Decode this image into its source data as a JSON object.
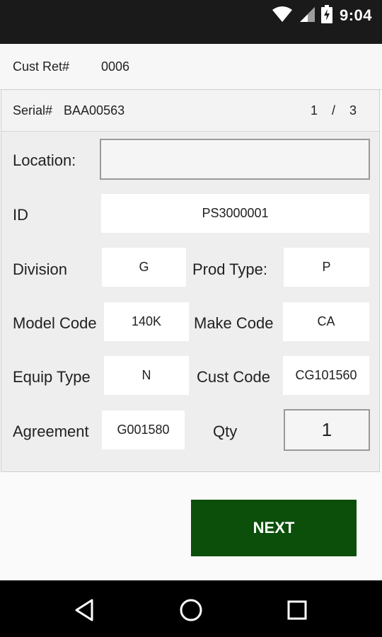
{
  "status_bar": {
    "time": "9:04",
    "icons": [
      "wifi-icon",
      "cell-signal-icon",
      "battery-icon"
    ]
  },
  "header": {
    "cust_ret_label": "Cust Ret#",
    "cust_ret_value": "0006"
  },
  "record": {
    "serial_label": "Serial#",
    "serial_value": "BAA00563",
    "page_current": "1",
    "page_separator": "/",
    "page_total": "3"
  },
  "form": {
    "location_label": "Location:",
    "location_value": "",
    "id_label": "ID",
    "id_value": "PS3000001",
    "division_label": "Division",
    "division_value": "G",
    "prod_type_label": "Prod Type:",
    "prod_type_value": "P",
    "model_code_label": "Model Code",
    "model_code_value": "140K",
    "make_code_label": "Make Code",
    "make_code_value": "CA",
    "equip_type_label": "Equip Type",
    "equip_type_value": "N",
    "cust_code_label": "Cust Code",
    "cust_code_value": "CG101560",
    "agreement_label": "Agreement",
    "agreement_value": "G001580",
    "qty_label": "Qty",
    "qty_value": "1"
  },
  "actions": {
    "next_label": "NEXT"
  },
  "nav_bar": {
    "icons": [
      "back-icon",
      "home-icon",
      "recents-icon"
    ]
  },
  "colors": {
    "primary_button": "#0b4f0b",
    "status_bar": "#1a1a1a",
    "nav_bar": "#000000"
  }
}
